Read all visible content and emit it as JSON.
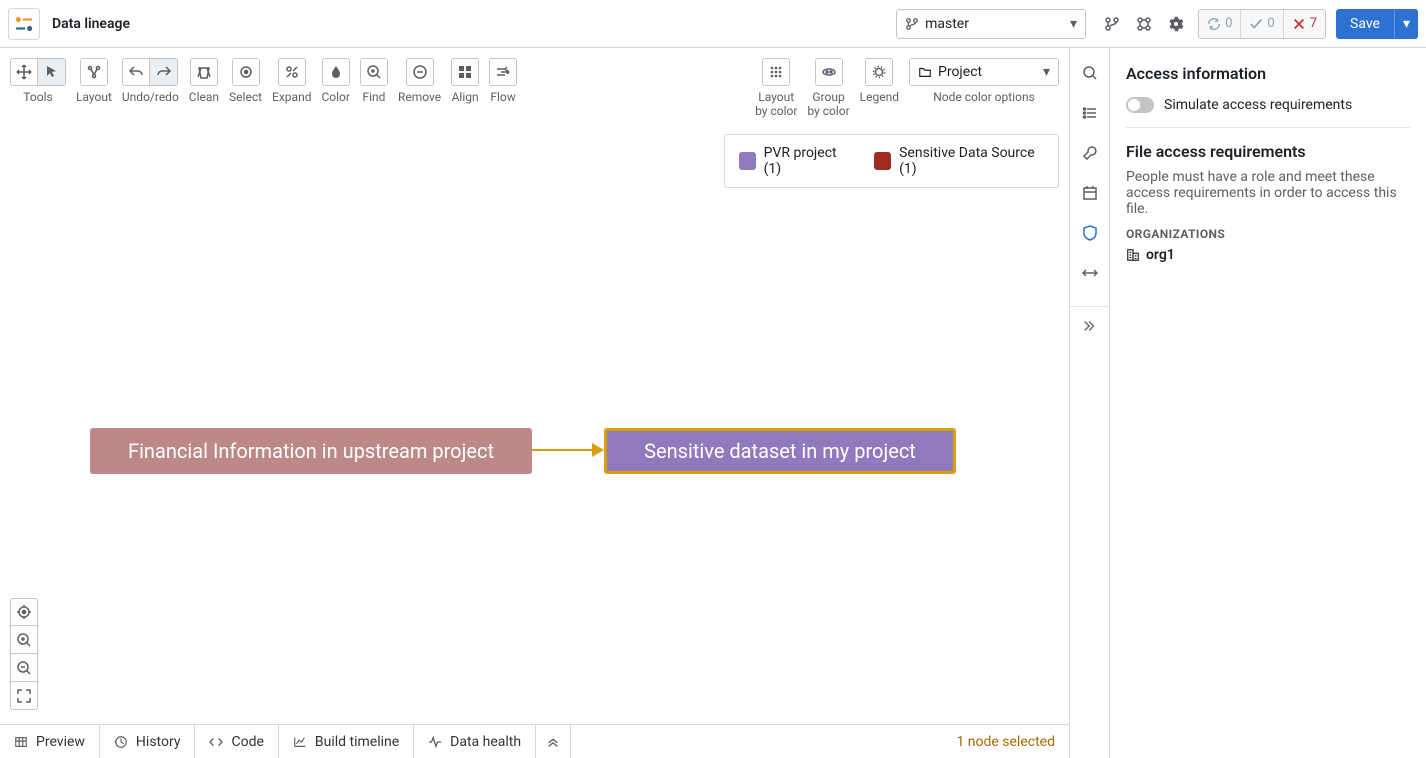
{
  "header": {
    "title": "Data lineage",
    "branch": "master",
    "status": {
      "sync": "0",
      "ok": "0",
      "err": "7"
    },
    "save_label": "Save"
  },
  "toolbar": {
    "tools": "Tools",
    "layout": "Layout",
    "undo_redo": "Undo/redo",
    "clean": "Clean",
    "select": "Select",
    "expand": "Expand",
    "color": "Color",
    "find": "Find",
    "remove": "Remove",
    "align": "Align",
    "flow": "Flow"
  },
  "rtoolbar": {
    "layout_by_color": "Layout\nby color",
    "group_by_color": "Group\nby color",
    "legend": "Legend",
    "node_color_options": "Node color options",
    "node_color_value": "Project"
  },
  "legend": {
    "items": [
      {
        "label": "PVR project (1)",
        "color": "#9179bd"
      },
      {
        "label": "Sensitive Data Source (1)",
        "color": "#a02b20"
      }
    ]
  },
  "canvas": {
    "nodes": [
      {
        "label": "Financial Information in upstream project"
      },
      {
        "label": "Sensitive dataset in my project"
      }
    ],
    "status": "1 node selected"
  },
  "bottom_tabs": {
    "preview": "Preview",
    "history": "History",
    "code": "Code",
    "build_timeline": "Build timeline",
    "data_health": "Data health"
  },
  "right_panel": {
    "title": "Access information",
    "simulate": "Simulate access requirements",
    "file_access_title": "File access requirements",
    "file_access_desc": "People must have a role and meet these access requirements in order to access this file.",
    "org_label": "ORGANIZATIONS",
    "org_name": "org1"
  }
}
